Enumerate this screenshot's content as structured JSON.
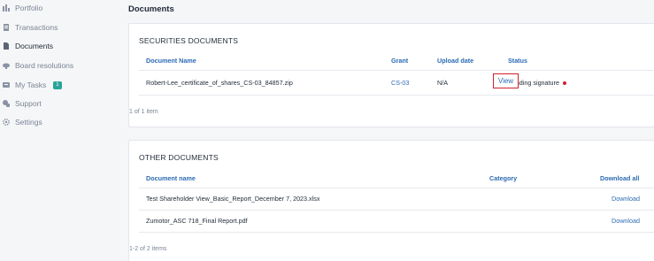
{
  "sidebar": {
    "items": [
      {
        "label": "Portfolio",
        "icon": "bar-chart-icon"
      },
      {
        "label": "Transactions",
        "icon": "receipt-icon"
      },
      {
        "label": "Documents",
        "icon": "document-icon"
      },
      {
        "label": "Board resolutions",
        "icon": "board-icon"
      },
      {
        "label": "My Tasks",
        "icon": "tasks-icon",
        "badge": "1"
      },
      {
        "label": "Support",
        "icon": "support-icon"
      },
      {
        "label": "Settings",
        "icon": "gear-icon"
      }
    ],
    "active_index": 2
  },
  "main": {
    "title": "Documents",
    "securities": {
      "title": "SECURITIES DOCUMENTS",
      "columns": [
        "Document Name",
        "Grant",
        "Upload date",
        "Status"
      ],
      "rows": [
        {
          "name": "Robert-Lee_certificate_of_shares_CS-03_84857.zip",
          "grant": "CS-03",
          "upload_date": "N/A",
          "status": "Pending signature",
          "action": "View"
        }
      ],
      "footer": "1 of 1 item"
    },
    "other": {
      "title": "OTHER DOCUMENTS",
      "columns": [
        "Document name",
        "Category"
      ],
      "download_all": "Download all",
      "rows": [
        {
          "name": "Test Shareholder View_Basic_Report_December 7, 2023.xlsx",
          "action": "Download"
        },
        {
          "name": "Zumotor_ASC 718_Final Report.pdf",
          "action": "Download"
        }
      ],
      "footer": "1-2 of 2 items"
    }
  },
  "colors": {
    "accent": "#2b6bb3",
    "status_dot": "#d0212a",
    "badge": "#2aa39a"
  }
}
